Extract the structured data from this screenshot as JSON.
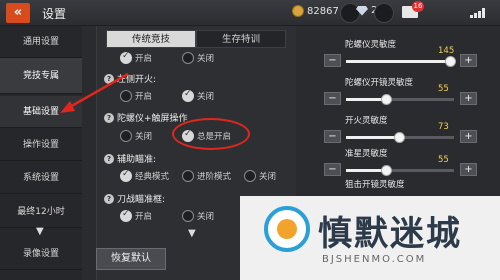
{
  "header": {
    "back_label": "«",
    "title": "设置",
    "coins": "82867",
    "gems": "292",
    "mail_badge": "16"
  },
  "sidebar": {
    "items": [
      {
        "label": "通用设置"
      },
      {
        "label": "竞技专属"
      },
      {
        "label": "基础设置"
      },
      {
        "label": "操作设置"
      },
      {
        "label": "系统设置"
      },
      {
        "label": "最终12小时"
      },
      {
        "label": "录像设置"
      }
    ]
  },
  "tabs": [
    {
      "label": "传统竞技"
    },
    {
      "label": "生存特训"
    }
  ],
  "options": {
    "row0": {
      "on": "开启",
      "off": "关闭"
    },
    "left_fire": {
      "label": "左侧开火:",
      "on": "开启",
      "off": "关闭"
    },
    "gyro": {
      "label": "陀螺仪+触屏操作",
      "off": "关闭",
      "always": "总是开启"
    },
    "aim_assist": {
      "label": "辅助瞄准:",
      "classic": "经典模式",
      "advanced": "进阶模式",
      "off": "关闭"
    },
    "knife_aim": {
      "label": "刀战瞄准框:",
      "on": "开启",
      "off": "关闭"
    }
  },
  "restore_button": "恢复默认",
  "sliders": [
    {
      "label": "陀螺仪灵敏度",
      "value": 145
    },
    {
      "label": "陀螺仪开镜灵敏度",
      "value": 55
    },
    {
      "label": "开火灵敏度",
      "value": 73
    },
    {
      "label": "准星灵敏度",
      "value": 55
    },
    {
      "label": "狙击开镜灵敏度",
      "value": ""
    }
  ],
  "watermark": {
    "title": "慎默迷城",
    "sub": "BJSHENMO.COM"
  },
  "colors": {
    "accent_red": "#e0261d",
    "value_yellow": "#f2d04e",
    "back_orange": "#d84b1d"
  }
}
